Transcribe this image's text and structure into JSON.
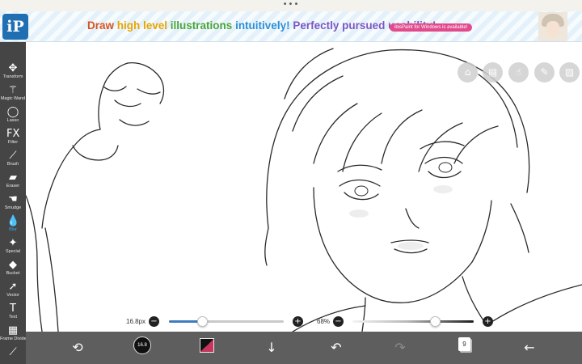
{
  "app": {
    "top_indicator": "•••",
    "logo_text": "iP"
  },
  "banner": {
    "headline_parts": [
      {
        "text": "Draw ",
        "color": "#d9531e"
      },
      {
        "text": "high level ",
        "color": "#e8a400"
      },
      {
        "text": "illustrations ",
        "color": "#49a53b"
      },
      {
        "text": "intuitively! ",
        "color": "#2c8fd6"
      },
      {
        "text": "Perfectly pursued usability!",
        "color": "#7a58c4"
      }
    ],
    "pill": "ibisPaint for Windows is available!"
  },
  "toolbar": {
    "tools": [
      {
        "id": "transform",
        "label": "Transform",
        "icon": "move-arrows-icon",
        "glyph": "✥",
        "active": false
      },
      {
        "id": "magic-wand",
        "label": "Magic Wand",
        "icon": "magic-wand-icon",
        "glyph": "⚚",
        "active": false
      },
      {
        "id": "lasso",
        "label": "Lasso",
        "icon": "lasso-icon",
        "glyph": "◯",
        "active": false
      },
      {
        "id": "filter",
        "label": "Filter",
        "icon": "filter-fx-icon",
        "glyph": "FX",
        "active": false
      },
      {
        "id": "brush",
        "label": "Brush",
        "icon": "brush-icon",
        "glyph": "⟋",
        "active": false
      },
      {
        "id": "eraser",
        "label": "Eraser",
        "icon": "eraser-icon",
        "glyph": "▰",
        "active": false
      },
      {
        "id": "smudge",
        "label": "Smudge",
        "icon": "smudge-finger-icon",
        "glyph": "☚",
        "active": false
      },
      {
        "id": "blur",
        "label": "Blur",
        "icon": "water-drop-icon",
        "glyph": "💧",
        "active": true
      },
      {
        "id": "special",
        "label": "Special",
        "icon": "sparkle-wand-icon",
        "glyph": "✦",
        "active": false
      },
      {
        "id": "bucket",
        "label": "Bucket",
        "icon": "paint-bucket-icon",
        "glyph": "◆",
        "active": false
      },
      {
        "id": "vector",
        "label": "Vector",
        "icon": "vector-arrow-icon",
        "glyph": "➚",
        "active": false
      },
      {
        "id": "text",
        "label": "Text",
        "icon": "text-t-icon",
        "glyph": "T",
        "active": false
      },
      {
        "id": "frame-divider",
        "label": "Frame Divider",
        "icon": "frame-grid-icon",
        "glyph": "▦",
        "active": false
      },
      {
        "id": "eyedropper",
        "label": "",
        "icon": "eyedropper-icon",
        "glyph": "⟋",
        "active": false
      }
    ]
  },
  "floating_buttons": [
    {
      "id": "camera",
      "icon": "camera-icon",
      "glyph": "⌂"
    },
    {
      "id": "material",
      "icon": "material-stack-icon",
      "glyph": "▤"
    },
    {
      "id": "hand",
      "icon": "hand-icon",
      "glyph": "☝"
    },
    {
      "id": "edit",
      "icon": "pencil-icon",
      "glyph": "✎"
    },
    {
      "id": "image",
      "icon": "image-icon",
      "glyph": "▨"
    }
  ],
  "sliders": {
    "size": {
      "value_text": "16.8px",
      "minus": "−",
      "plus": "+",
      "fraction": 0.29
    },
    "opacity": {
      "value_text": "68%",
      "minus": "−",
      "plus": "+",
      "fraction": 0.68
    }
  },
  "bottombar": {
    "brush_preview_text": "16.8",
    "layer_count": "9",
    "accent_color": "#c4365b",
    "buttons": {
      "tool_switch_icon": "tool-switch-icon",
      "import_icon": "download-arrow-icon",
      "undo_icon": "undo-icon",
      "redo_icon": "redo-icon",
      "layers_icon": "layers-icon",
      "back_icon": "back-arrow-icon"
    }
  },
  "colors": {
    "toolbar_bg": "#454545",
    "bottombar_bg": "#5e5e5e",
    "active_tool": "#41a7ee",
    "slider_fill": "#3e7bbf"
  }
}
